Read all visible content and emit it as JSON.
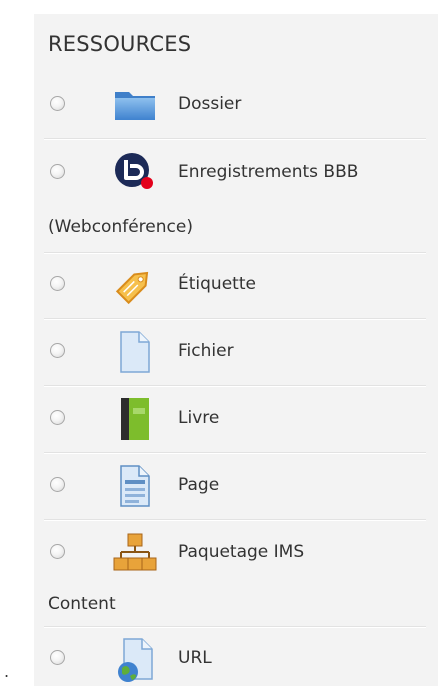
{
  "section": {
    "title": "RESSOURCES"
  },
  "items": [
    {
      "label": "Dossier",
      "icon": "folder-icon"
    },
    {
      "label": "Enregistrements BBB",
      "label_continued": "(Webconférence)",
      "icon": "bigbluebutton-icon"
    },
    {
      "label": "Étiquette",
      "icon": "label-tag-icon"
    },
    {
      "label": "Fichier",
      "icon": "file-icon"
    },
    {
      "label": "Livre",
      "icon": "book-icon"
    },
    {
      "label": "Page",
      "icon": "page-icon"
    },
    {
      "label": "Paquetage IMS",
      "label_continued": "Content",
      "icon": "ims-package-icon"
    },
    {
      "label": "URL",
      "icon": "url-globe-icon"
    }
  ],
  "stray_mark": ".",
  "colors": {
    "panel_bg": "#f3f3f3",
    "text": "#333333",
    "folder_blue": "#5b9bd5",
    "bbb_navy": "#1c2a57",
    "bbb_red": "#e3001b",
    "book_green": "#7dbd2c",
    "tag_orange": "#f3a733",
    "package_orange": "#e8a33a"
  }
}
